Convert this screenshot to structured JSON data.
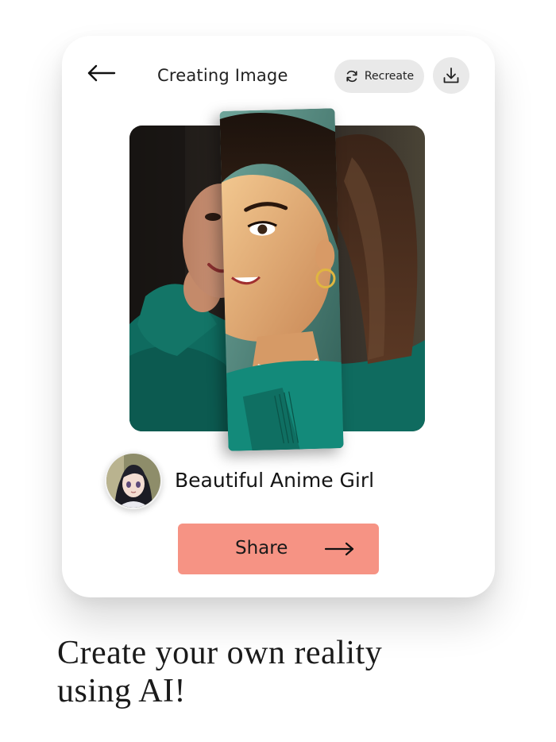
{
  "header": {
    "back_icon": "arrow-left-icon",
    "title": "Creating Image",
    "recreate_label": "Recreate",
    "recreate_icon": "refresh-icon",
    "download_icon": "download-icon"
  },
  "preview": {
    "original_photo": "photo-of-woman-in-green-jacket",
    "ai_strip": "stylized-painted-strip"
  },
  "style": {
    "avatar": "anime-girl-avatar",
    "name": "Beautiful Anime Girl"
  },
  "share": {
    "label": "Share",
    "icon": "arrow-right-icon"
  },
  "tagline": {
    "line1": "Create your own reality",
    "line2": "using AI!"
  },
  "colors": {
    "share_button": "#f69384",
    "pill_background": "#e9e9e9",
    "card_background": "#ffffff",
    "text": "#1a1a1a"
  }
}
